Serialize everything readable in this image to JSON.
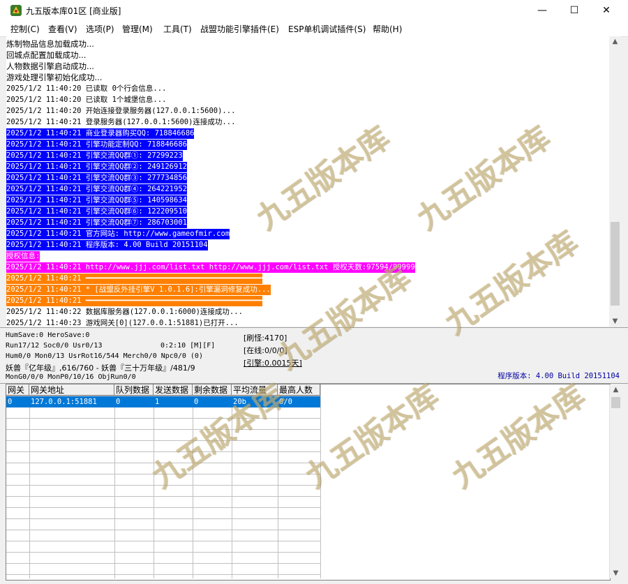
{
  "window": {
    "title": "九五版本库01区 [商业版]",
    "minimize": "—",
    "maximize": "☐",
    "close": "✕"
  },
  "menu": [
    {
      "label": "控制(C)"
    },
    {
      "label": "查看(V)"
    },
    {
      "label": "选项(P)"
    },
    {
      "label": "管理(M)"
    },
    {
      "label": "工具(T)"
    },
    {
      "label": "战盟功能引擎插件(E)"
    },
    {
      "label": "ESP单机调试插件(S)"
    },
    {
      "label": "帮助(H)"
    }
  ],
  "log": {
    "lines": [
      {
        "text": "炼制物品信息加载成功...",
        "bg": "",
        "fg": "#000000"
      },
      {
        "text": "回城点配置加载成功...",
        "bg": "",
        "fg": "#000000"
      },
      {
        "text": "人物数据引擎启动成功...",
        "bg": "",
        "fg": "#000000"
      },
      {
        "text": "游戏处理引擎初始化成功...",
        "bg": "",
        "fg": "#000000"
      },
      {
        "text": "2025/1/2 11:40:20 已读取 0个行会信息...",
        "bg": "",
        "fg": "#000000"
      },
      {
        "text": "2025/1/2 11:40:20 已读取 1个城堡信息...",
        "bg": "",
        "fg": "#000000"
      },
      {
        "text": "2025/1/2 11:40:20 开始连接登录服务器(127.0.0.1:5600)...",
        "bg": "",
        "fg": "#000000"
      },
      {
        "text": "2025/1/2 11:40:21 登录服务器(127.0.0.1:5600)连接成功...",
        "bg": "",
        "fg": "#000000"
      },
      {
        "text": "2025/1/2 11:40:21 商业登录器购买QQ: 718846686",
        "bg": "#0000ff",
        "fg": "#ffffff"
      },
      {
        "text": "2025/1/2 11:40:21 引擎功能定制QQ: 718846686",
        "bg": "#0000ff",
        "fg": "#ffffff"
      },
      {
        "text": "2025/1/2 11:40:21 引擎交流QQ群①: 27299223",
        "bg": "#0000ff",
        "fg": "#ffffff"
      },
      {
        "text": "2025/1/2 11:40:21 引擎交流QQ群②: 249126912",
        "bg": "#0000ff",
        "fg": "#ffffff"
      },
      {
        "text": "2025/1/2 11:40:21 引擎交流QQ群③: 277734856",
        "bg": "#0000ff",
        "fg": "#ffffff"
      },
      {
        "text": "2025/1/2 11:40:21 引擎交流QQ群④: 264221952",
        "bg": "#0000ff",
        "fg": "#ffffff"
      },
      {
        "text": "2025/1/2 11:40:21 引擎交流QQ群⑤: 140598634",
        "bg": "#0000ff",
        "fg": "#ffffff"
      },
      {
        "text": "2025/1/2 11:40:21 引擎交流QQ群⑥: 122209510",
        "bg": "#0000ff",
        "fg": "#ffffff"
      },
      {
        "text": "2025/1/2 11:40:21 引擎交流QQ群⑦: 286703001",
        "bg": "#0000ff",
        "fg": "#ffffff"
      },
      {
        "text": "2025/1/2 11:40:21 官方网站: http://www.gameofmir.com",
        "bg": "#0000ff",
        "fg": "#ffffff"
      },
      {
        "text": "2025/1/2 11:40:21 程序版本: 4.00 Build 20151104",
        "bg": "#0000ff",
        "fg": "#ffffff"
      },
      {
        "text": "授权信息:",
        "bg": "#ff00ff",
        "fg": "#ffffff"
      },
      {
        "text": "2025/1/2 11:40:21 http://www.jjj.com/list.txt http://www.jjj.com/list.txt 授权天数:97594/99999",
        "bg": "#ff00ff",
        "fg": "#ffffff"
      },
      {
        "text": "2025/1/2 11:40:21 ━━━━━━━━━━━━━━━━━━━━━━━━━━━━━━━━━━━━━━━━",
        "bg": "#ff8000",
        "fg": "#ffffff"
      },
      {
        "text": "2025/1/2 11:40:21 * [战盟反外挂引擎V 1.0.1.6]:引擎漏洞修复成功...",
        "bg": "#ff8000",
        "fg": "#ffffff"
      },
      {
        "text": "2025/1/2 11:40:21 ━━━━━━━━━━━━━━━━━━━━━━━━━━━━━━━━━━━━━━━━",
        "bg": "#ff8000",
        "fg": "#ffffff"
      },
      {
        "text": "2025/1/2 11:40:22 数据库服务器(127.0.0.1:6000)连接成功...",
        "bg": "",
        "fg": "#000000"
      },
      {
        "text": "2025/1/2 11:40:23 游戏网关[0](127.0.0.1:51881)已打开...",
        "bg": "",
        "fg": "#000000"
      }
    ]
  },
  "status": {
    "line1": "HumSave:0 HeroSave:0",
    "line2a": "Run17/12 Soc0/0 Usr0/13",
    "line2b": "0:2:10 [M][F]",
    "line3": "Hum0/0 Mon0/13 UsrRot16/544 Merch0/0 Npc0/0 (0)",
    "line4": "妖兽『亿年级』,616/760 - 妖兽『三十万年级』/481/9",
    "line5": "MonG0/0/0 MonP0/10/16 ObjRun0/0",
    "refresh": "[刷怪:4170]",
    "online": "[在线:0/0/0]",
    "engine": "[引擎:0.0015天]",
    "version": "程序版本: 4.00 Build 20151104"
  },
  "gateway_table": {
    "columns": [
      "网关",
      "网关地址",
      "队列数据",
      "发送数据",
      "剩余数据",
      "平均流量",
      "最高人数"
    ],
    "rows": [
      [
        "0",
        "127.0.0.1:51881",
        "0",
        "1",
        "0",
        "20b",
        "0/0"
      ]
    ]
  },
  "watermark": "九五版本库",
  "colors": {
    "selection": "#0078d7",
    "blue_highlight": "#0000ff",
    "magenta_highlight": "#ff00ff",
    "orange_highlight": "#ff8000",
    "version_text": "#0000a0"
  }
}
